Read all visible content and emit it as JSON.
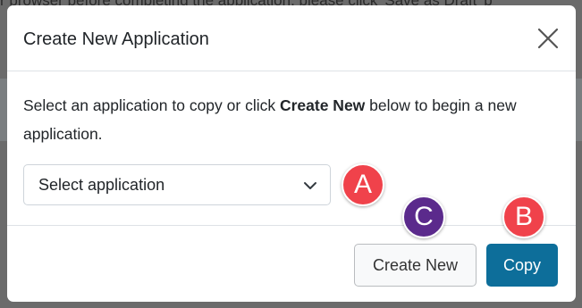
{
  "backdrop": {
    "text": "r browser before completing the application, please click 'Save as Draft' b"
  },
  "modal": {
    "title": "Create New Application",
    "close_icon": "close-icon",
    "body": {
      "text_before": "Select an application to copy or click ",
      "text_bold": "Create New",
      "text_after": " below to begin a new application."
    },
    "select": {
      "value": "Select application",
      "chevron_icon": "chevron-down-icon"
    },
    "footer": {
      "create_new_label": "Create New",
      "copy_label": "Copy"
    }
  },
  "markers": [
    {
      "label": "A",
      "color": "#f0424b"
    },
    {
      "label": "B",
      "color": "#f0424b"
    },
    {
      "label": "C",
      "color": "#5b2a8c"
    }
  ],
  "colors": {
    "primary": "#0d6e9a",
    "marker_red": "#f0424b",
    "marker_purple": "#5b2a8c"
  }
}
